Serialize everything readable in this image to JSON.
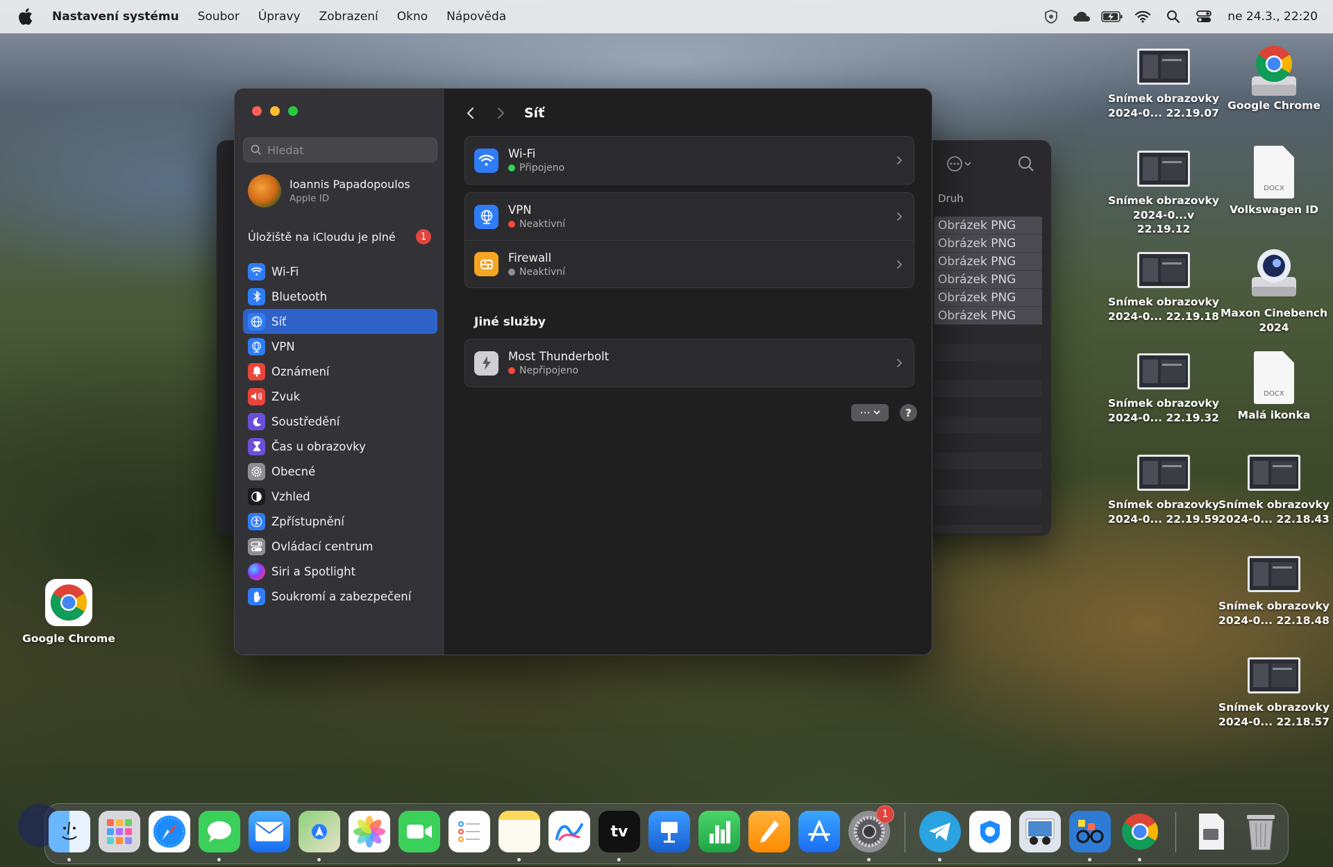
{
  "menubar": {
    "app_name": "Nastavení systému",
    "items": [
      "Soubor",
      "Úpravy",
      "Zobrazení",
      "Okno",
      "Nápověda"
    ],
    "clock": "ne 24.3., 22:20"
  },
  "sidebar": {
    "search_placeholder": "Hledat",
    "user_name": "Ioannis Papadopoulos",
    "user_sub": "Apple ID",
    "icloud_text": "Úložiště na iCloudu je plné",
    "icloud_badge": "1",
    "groups": [
      [
        {
          "label": "Wi-Fi",
          "icon": "wifi-icon",
          "color": "#2f7cf6"
        },
        {
          "label": "Bluetooth",
          "icon": "bluetooth-icon",
          "color": "#2f7cf6"
        },
        {
          "label": "Síť",
          "icon": "globe-icon",
          "color": "#2f7cf6",
          "active": true
        },
        {
          "label": "VPN",
          "icon": "vpn-icon",
          "color": "#2f7cf6"
        }
      ],
      [
        {
          "label": "Oznámení",
          "icon": "bell-icon",
          "color": "#e8453c"
        },
        {
          "label": "Zvuk",
          "icon": "speaker-icon",
          "color": "#e8453c"
        },
        {
          "label": "Soustředění",
          "icon": "moon-icon",
          "color": "#6b4fd8"
        },
        {
          "label": "Čas u obrazovky",
          "icon": "hourglass-icon",
          "color": "#6b4fd8"
        }
      ],
      [
        {
          "label": "Obecné",
          "icon": "gear-icon",
          "color": "#8e8e93"
        },
        {
          "label": "Vzhled",
          "icon": "appearance-icon",
          "color": "#1c1c1e"
        },
        {
          "label": "Zpřístupnění",
          "icon": "accessibility-icon",
          "color": "#2f7cf6"
        },
        {
          "label": "Ovládací centrum",
          "icon": "control-center-icon",
          "color": "#8e8e93"
        },
        {
          "label": "Siri a Spotlight",
          "icon": "siri-icon",
          "color": "#c14bd6"
        },
        {
          "label": "Soukromí a zabezpečení",
          "icon": "hand-icon",
          "color": "#2f7cf6"
        }
      ]
    ]
  },
  "content": {
    "title": "Síť",
    "services": [
      {
        "name": "Wi-Fi",
        "status": "Připojeno",
        "status_color": "#30d158",
        "icon": "wifi-icon",
        "color": "#2f7cf6"
      },
      {
        "name": "VPN",
        "status": "Neaktivní",
        "status_color": "#ff453a",
        "icon": "vpn-icon",
        "color": "#2f7cf6"
      },
      {
        "name": "Firewall",
        "status": "Neaktivní",
        "status_color": "#8e8e93",
        "icon": "firewall-icon",
        "color": "#f5a623"
      }
    ],
    "other_title": "Jiné služby",
    "other": [
      {
        "name": "Most Thunderbolt",
        "status": "Nepřipojeno",
        "status_color": "#ff453a",
        "icon": "thunderbolt-icon",
        "color": "#8e8e93"
      }
    ],
    "more_label": "···",
    "help_label": "?"
  },
  "back_window": {
    "column": "Druh",
    "rows": [
      "Obrázek PNG",
      "Obrázek PNG",
      "Obrázek PNG",
      "Obrázek PNG",
      "Obrázek PNG",
      "Obrázek PNG"
    ]
  },
  "desktop": {
    "left_icon": "Google Chrome",
    "icons": [
      {
        "l1": "Snímek obrazovky",
        "l2": "2024-0... 22.19.07",
        "kind": "thumb"
      },
      {
        "l1": "Google Chrome",
        "l2": "",
        "kind": "chrome"
      },
      {
        "l1": "Snímek obrazovky",
        "l2": "2024-0...v 22.19.12",
        "kind": "thumb"
      },
      {
        "l1": "Volkswagen ID",
        "l2": "",
        "kind": "docx"
      },
      {
        "l1": "Snímek obrazovky",
        "l2": "2024-0... 22.19.18",
        "kind": "thumb"
      },
      {
        "l1": "Maxon Cinebench",
        "l2": "2024",
        "kind": "disk"
      },
      {
        "l1": "Snímek obrazovky",
        "l2": "2024-0... 22.19.32",
        "kind": "thumb"
      },
      {
        "l1": "Malá ikonka",
        "l2": "",
        "kind": "docx"
      },
      {
        "l1": "Snímek obrazovky",
        "l2": "2024-0... 22.19.59",
        "kind": "thumb"
      },
      {
        "l1": "Snímek obrazovky",
        "l2": "2024-0... 22.18.43",
        "kind": "thumb"
      },
      {
        "l1": "Snímek obrazovky",
        "l2": "2024-0... 22.18.48",
        "kind": "thumb"
      },
      {
        "l1": "Snímek obrazovky",
        "l2": "2024-0... 22.18.57",
        "kind": "thumb"
      }
    ],
    "docx_label": "DOCX"
  },
  "dock": {
    "settings_badge": "1",
    "apps": [
      "finder",
      "launchpad",
      "safari",
      "messages",
      "mail",
      "maps",
      "photos",
      "facetime",
      "reminders",
      "notes",
      "freeform",
      "tv",
      "keynote",
      "numbers",
      "pages",
      "app-store",
      "system-settings",
      "telegram",
      "proxyman",
      "preview",
      "glasses",
      "chrome",
      "downloads",
      "trash"
    ],
    "tv_label": "tv"
  }
}
